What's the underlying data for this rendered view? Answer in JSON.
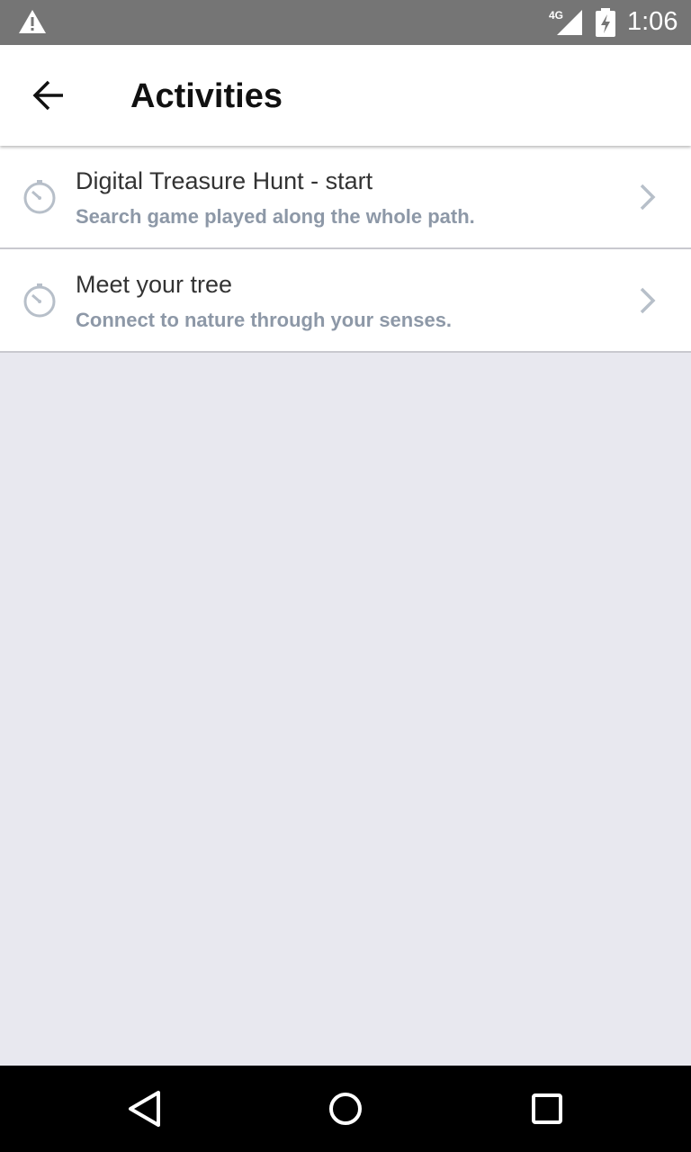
{
  "status_bar": {
    "network": "4G",
    "time": "1:06",
    "icons": [
      "warning-icon",
      "signal-icon",
      "battery-charging-icon"
    ]
  },
  "app_bar": {
    "title": "Activities",
    "back_icon": "arrow-left-icon"
  },
  "activities": [
    {
      "title": "Digital Treasure Hunt - start",
      "subtitle": "Search game played along the whole path.",
      "icon": "timer-icon"
    },
    {
      "title": "Meet your tree",
      "subtitle": "Connect to nature through your senses.",
      "icon": "timer-icon"
    }
  ],
  "nav_bar": {
    "icons": [
      "back-triangle-icon",
      "home-circle-icon",
      "recents-square-icon"
    ]
  },
  "colors": {
    "status_bar": "#757575",
    "app_bar": "#ffffff",
    "background": "#e8e8ef",
    "subtitle": "#8d98a7",
    "icon": "#b7bfc9",
    "nav_bar": "#000000"
  }
}
